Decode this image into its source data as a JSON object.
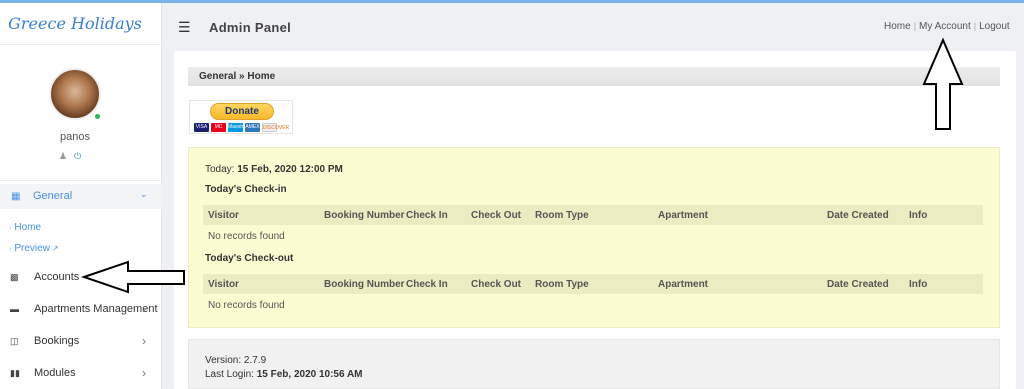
{
  "app": {
    "brand": "Greece Holidays",
    "panel_title": "Admin Panel"
  },
  "user": {
    "name": "panos"
  },
  "sidebar": {
    "general": "General",
    "subitems": [
      "Home",
      "Preview"
    ],
    "items": [
      "Accounts",
      "Apartments Management",
      "Bookings",
      "Modules"
    ]
  },
  "toplinks": {
    "home": "Home",
    "account": "My Account",
    "logout": "Logout"
  },
  "breadcrumb": "General » Home",
  "donate": {
    "label": "Donate",
    "cards": [
      "VISA",
      "MC",
      "Maestro",
      "AMEX",
      "DISCOVER"
    ]
  },
  "today": {
    "prefix": "Today:",
    "value": "15 Feb, 2020 12:00 PM"
  },
  "checkin": {
    "title": "Today's Check-in",
    "columns": [
      "Visitor",
      "Booking Number",
      "Check In",
      "Check Out",
      "Room Type",
      "Apartment",
      "Date Created",
      "Info"
    ],
    "empty": "No records found"
  },
  "checkout": {
    "title": "Today's Check-out",
    "columns": [
      "Visitor",
      "Booking Number",
      "Check In",
      "Check Out",
      "Room Type",
      "Apartment",
      "Date Created",
      "Info"
    ],
    "empty": "No records found"
  },
  "footer": {
    "version": "Version: 2.7.9",
    "last_login_prefix": "Last Login:",
    "last_login_value": "15 Feb, 2020 10:56 AM"
  },
  "colors": {
    "accent": "#4a90e2",
    "brand": "#3a7fcd",
    "highlight": "#fcfcd3"
  }
}
